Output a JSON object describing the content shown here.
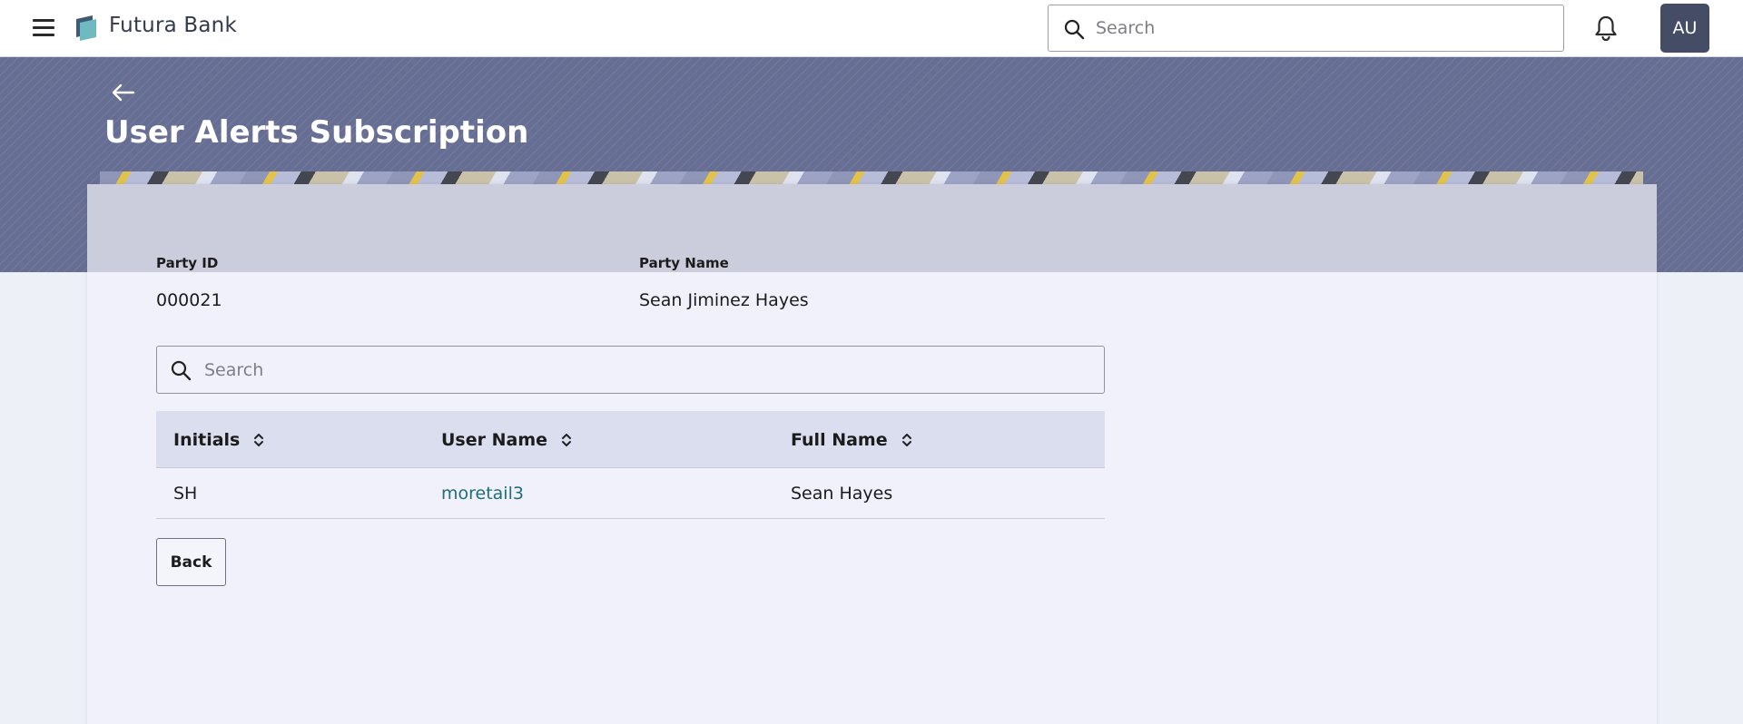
{
  "header": {
    "brand": "Futura Bank",
    "search_placeholder": "Search",
    "avatar_initials": "AU"
  },
  "page": {
    "title": "User Alerts Subscription"
  },
  "party": {
    "id_label": "Party ID",
    "id_value": "000021",
    "name_label": "Party Name",
    "name_value": "Sean Jiminez Hayes"
  },
  "search": {
    "placeholder": "Search"
  },
  "table": {
    "headers": [
      "Initials",
      "User Name",
      "Full Name"
    ],
    "rows": [
      {
        "initials": "SH",
        "username": "moretail3",
        "fullname": "Sean Hayes"
      }
    ]
  },
  "actions": {
    "back_label": "Back"
  },
  "colors": {
    "hero": "#676e93",
    "avatar": "#454c66",
    "link": "#1f6e7a",
    "table_header": "#dadeef"
  }
}
